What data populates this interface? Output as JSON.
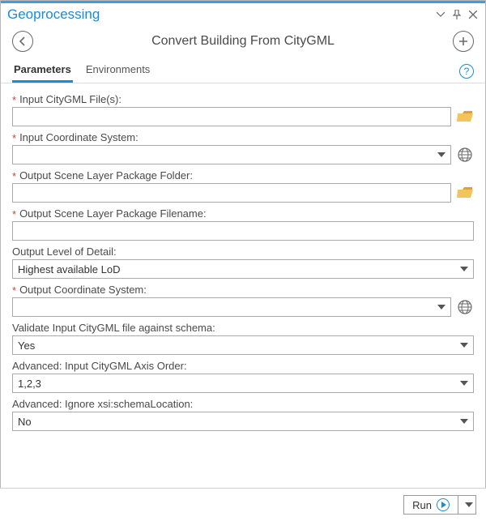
{
  "window": {
    "title": "Geoprocessing"
  },
  "header": {
    "toolTitle": "Convert Building From CityGML"
  },
  "tabs": {
    "parameters": "Parameters",
    "environments": "Environments"
  },
  "fields": {
    "inputFiles": {
      "label": "Input CityGML File(s):",
      "required": true,
      "value": ""
    },
    "inputCRS": {
      "label": "Input Coordinate System:",
      "required": true,
      "value": ""
    },
    "outFolder": {
      "label": "Output Scene Layer Package Folder:",
      "required": true,
      "value": ""
    },
    "outFilename": {
      "label": "Output Scene Layer Package Filename:",
      "required": true,
      "value": ""
    },
    "lod": {
      "label": "Output Level of Detail:",
      "required": false,
      "value": "Highest available LoD"
    },
    "outputCRS": {
      "label": "Output Coordinate System:",
      "required": true,
      "value": ""
    },
    "validate": {
      "label": "Validate Input CityGML file against schema:",
      "required": false,
      "value": "Yes"
    },
    "axisOrder": {
      "label": "Advanced: Input CityGML Axis Order:",
      "required": false,
      "value": "1,2,3"
    },
    "ignoreSchema": {
      "label": "Advanced: Ignore xsi:schemaLocation:",
      "required": false,
      "value": "No"
    }
  },
  "footer": {
    "run": "Run"
  }
}
